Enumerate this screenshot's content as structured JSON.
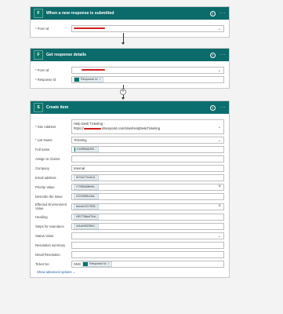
{
  "trigger": {
    "title": "When a new response is submitted",
    "form_id_label": "* Form Id"
  },
  "get_details": {
    "title": "Get response details",
    "form_id_label": "* Form Id",
    "response_id_label": "* Response Id",
    "response_id_token": "Response Id"
  },
  "create_item": {
    "title": "Create item",
    "site_label": "* Site Address",
    "site_line1": "Help Desk Ticketing -",
    "site_line2_prefix": "https://",
    "site_line2_suffix": ".sharepoint.com/sites/HelpDeskTicketing",
    "list_label": "* List Name",
    "list_value": "Ticketing",
    "fields": [
      {
        "label": "Full name",
        "token": "r1b0ff5d8d90...",
        "clear": false
      },
      {
        "label": "Assign to Claims",
        "token": "",
        "clear": false
      },
      {
        "label": "Company",
        "value": "Internal",
        "clear": false
      },
      {
        "label": "Email address",
        "token": "r67eb77ecb12...",
        "clear": false
      },
      {
        "label": "Priority Value",
        "token": "r77f85d0ffe9e...",
        "clear": true
      },
      {
        "label": "Describe the Issue",
        "token": "r224355fc2ad...",
        "clear": false
      },
      {
        "label": "Effected Environment Value",
        "token": "rbeae1217535...",
        "clear": true
      },
      {
        "label": "Heading",
        "token": "r957786a47fcb...",
        "clear": false
      },
      {
        "label": "Steps for reproduce",
        "token": "r44ab9023fb0...",
        "clear": false
      },
      {
        "label": "Status Value",
        "token": "",
        "clear": false
      },
      {
        "label": "Resolution summary",
        "token": "",
        "clear": false
      },
      {
        "label": "Detail Resolution",
        "token": "",
        "clear": false
      }
    ],
    "ticket_label": "Ticket No",
    "ticket_prefix": "SNG",
    "ticket_token": "Response Id",
    "advanced": "Show advanced options"
  }
}
